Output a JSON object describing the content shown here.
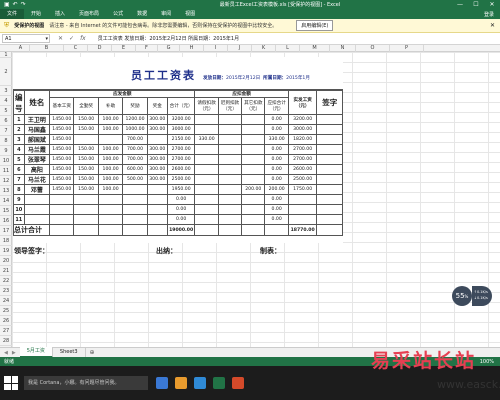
{
  "window": {
    "title": "最新员工Excel工资表模板.xls [受保护的视图] - Excel",
    "qat": [
      "save-icon",
      "undo-icon",
      "redo-icon"
    ],
    "controls": [
      "—",
      "☐",
      "✕"
    ]
  },
  "ribbon": {
    "tabs": [
      "文件",
      "开始",
      "插入",
      "页面布局",
      "公式",
      "数据",
      "审阅",
      "视图"
    ],
    "right": "登录"
  },
  "message_bar": {
    "title": "受保护的视图",
    "text": "请注意 - 来自 Internet 的文件可能包含病毒。除非您需要编辑，否则保持在受保护的视图中比较安全。",
    "button": "启用编辑(E)",
    "close": "✕"
  },
  "formula_bar": {
    "name_box": "A1",
    "formula": "员工工资表  发放日期：2015年2月12日  所属日期：2015年1月"
  },
  "columns": [
    "A",
    "B",
    "C",
    "D",
    "E",
    "F",
    "G",
    "H",
    "I",
    "J",
    "K",
    "L",
    "M",
    "N",
    "O",
    "P"
  ],
  "rows": [
    "1",
    "2",
    "3",
    "4",
    "5",
    "6",
    "7",
    "8",
    "9",
    "10",
    "11",
    "12",
    "13",
    "14",
    "15",
    "16",
    "17",
    "18",
    "19",
    "20",
    "21",
    "22",
    "23",
    "24",
    "25",
    "26",
    "27",
    "28",
    "29",
    "30"
  ],
  "payroll": {
    "title": "员工工资表",
    "date_label": "发放日期：",
    "date_value": "2015年2月12日",
    "period_label": "所属日期：",
    "period_value": "2015年1月",
    "headers": {
      "no": "编号",
      "name": "姓名",
      "payable": "应发金额",
      "deduct": "应扣金额",
      "net": "实发工资（元）",
      "sign": "签字",
      "sub": [
        "基本工资",
        "全勤奖",
        "补助",
        "奖励",
        "奖金",
        "合计（元）",
        "请假扣款（元）",
        "迟到扣款（元）",
        "其它扣款（元）",
        "应扣合计（元）"
      ]
    },
    "rows": [
      {
        "no": "1",
        "name": "王卫明",
        "c": [
          "1450.00",
          "150.00",
          "100.00",
          "1200.00",
          "300.00",
          "3200.00",
          "",
          "",
          "",
          "0.00",
          "3200.00"
        ]
      },
      {
        "no": "2",
        "name": "马国鑫",
        "c": [
          "1450.00",
          "150.00",
          "100.00",
          "1000.00",
          "300.00",
          "3000.00",
          "",
          "",
          "",
          "0.00",
          "3000.00"
        ]
      },
      {
        "no": "3",
        "name": "郝国斌",
        "c": [
          "1450.00",
          "",
          "",
          "700.00",
          "",
          "2150.00",
          "330.00",
          "",
          "",
          "330.00",
          "1820.00"
        ]
      },
      {
        "no": "4",
        "name": "马兰霞",
        "c": [
          "1450.00",
          "150.00",
          "100.00",
          "700.00",
          "300.00",
          "2700.00",
          "",
          "",
          "",
          "0.00",
          "2700.00"
        ]
      },
      {
        "no": "5",
        "name": "张翠琴",
        "c": [
          "1450.00",
          "150.00",
          "100.00",
          "700.00",
          "300.00",
          "2700.00",
          "",
          "",
          "",
          "0.00",
          "2700.00"
        ]
      },
      {
        "no": "6",
        "name": "高阳",
        "c": [
          "1450.00",
          "150.00",
          "100.00",
          "600.00",
          "300.00",
          "2600.00",
          "",
          "",
          "",
          "0.00",
          "2600.00"
        ]
      },
      {
        "no": "7",
        "name": "马兰花",
        "c": [
          "1450.00",
          "150.00",
          "100.00",
          "500.00",
          "300.00",
          "2500.00",
          "",
          "",
          "",
          "0.00",
          "2500.00"
        ]
      },
      {
        "no": "8",
        "name": "邓蕾",
        "c": [
          "1450.00",
          "150.00",
          "100.00",
          "",
          "",
          "1950.00",
          "",
          "",
          "200.00",
          "200.00",
          "1750.00"
        ]
      },
      {
        "no": "9",
        "name": "",
        "c": [
          "",
          "",
          "",
          "",
          "",
          "0.00",
          "",
          "",
          "",
          "0.00",
          ""
        ]
      },
      {
        "no": "10",
        "name": "",
        "c": [
          "",
          "",
          "",
          "",
          "",
          "0.00",
          "",
          "",
          "",
          "0.00",
          ""
        ]
      },
      {
        "no": "11",
        "name": "",
        "c": [
          "",
          "",
          "",
          "",
          "",
          "0.00",
          "",
          "",
          "",
          "0.00",
          ""
        ]
      }
    ],
    "total": {
      "label": "总计合计",
      "sum": "19000.00",
      "net": "18770.00"
    },
    "footer": {
      "leader": "领导签字：",
      "cashier": "出纳：",
      "maker": "制表："
    }
  },
  "sheets": [
    "5月工资",
    "Sheet3"
  ],
  "status": {
    "left": "就绪",
    "zoom": "100%"
  },
  "taskbar": {
    "cortana": "我是 Cortana，小娜。有问题尽管问我。",
    "app_colors": [
      "#3a78d4",
      "#e89b2e",
      "#2f8ad6",
      "#217346",
      "#d44a2a"
    ]
  },
  "overlay": {
    "badge": "55",
    "badge_suffix": "%",
    "up": "0.1K/s",
    "down": "0.1K/s"
  },
  "watermark": {
    "line1": "易采站长站",
    "line2": "www.easck.com"
  }
}
